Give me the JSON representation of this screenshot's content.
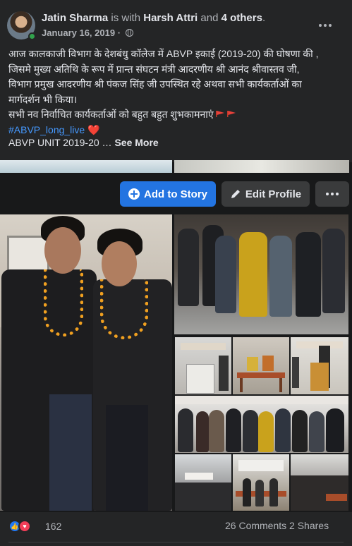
{
  "post": {
    "author": "Jatin Sharma",
    "with_text": "is with",
    "tagged": "Harsh Attri",
    "and_text": "and",
    "others": "4 others",
    "period": ".",
    "date": "January 16, 2019",
    "separator": "·",
    "privacy_icon": "globe-icon",
    "more_icon": "more-horizontal-icon",
    "body_lines": [
      "आज कालकाजी विभाग के देशबंधु कॉलेज में ABVP इकाई (2019-20) की घोषणा की ,",
      "जिसमे मुख्य अतिथि के रूप में प्रान्त संघटन मंत्री आदरणीय श्री आनंद श्रीवास्तव जी,",
      "विभाग प्रमुख आदरणीय श्री पंकज सिंह जी उपस्थित रहे अथवा सभी कार्यकर्ताओं का",
      "मार्गदर्शन भी किया।",
      "सभी नव निर्वाचित कार्यकर्ताओं को बहुत बहुत शुभकामनाएं"
    ],
    "hashtag": "#ABVP_long_live",
    "heart_emoji": "❤️",
    "unit_text": "ABVP UNIT 2019-20 …",
    "see_more": "See More"
  },
  "actions": {
    "add_to_story": "Add to Story",
    "edit_profile": "Edit Profile",
    "more_icon": "more-horizontal-icon"
  },
  "footer": {
    "reaction_count": "162",
    "comments": "26 Comments",
    "shares": "2 Shares"
  },
  "colors": {
    "background": "#18191a",
    "card": "#242526",
    "primary_button": "#2374e1",
    "secondary_button": "#3a3b3c",
    "link": "#4599ff",
    "text": "#e4e6eb",
    "muted": "#b0b3b8"
  }
}
